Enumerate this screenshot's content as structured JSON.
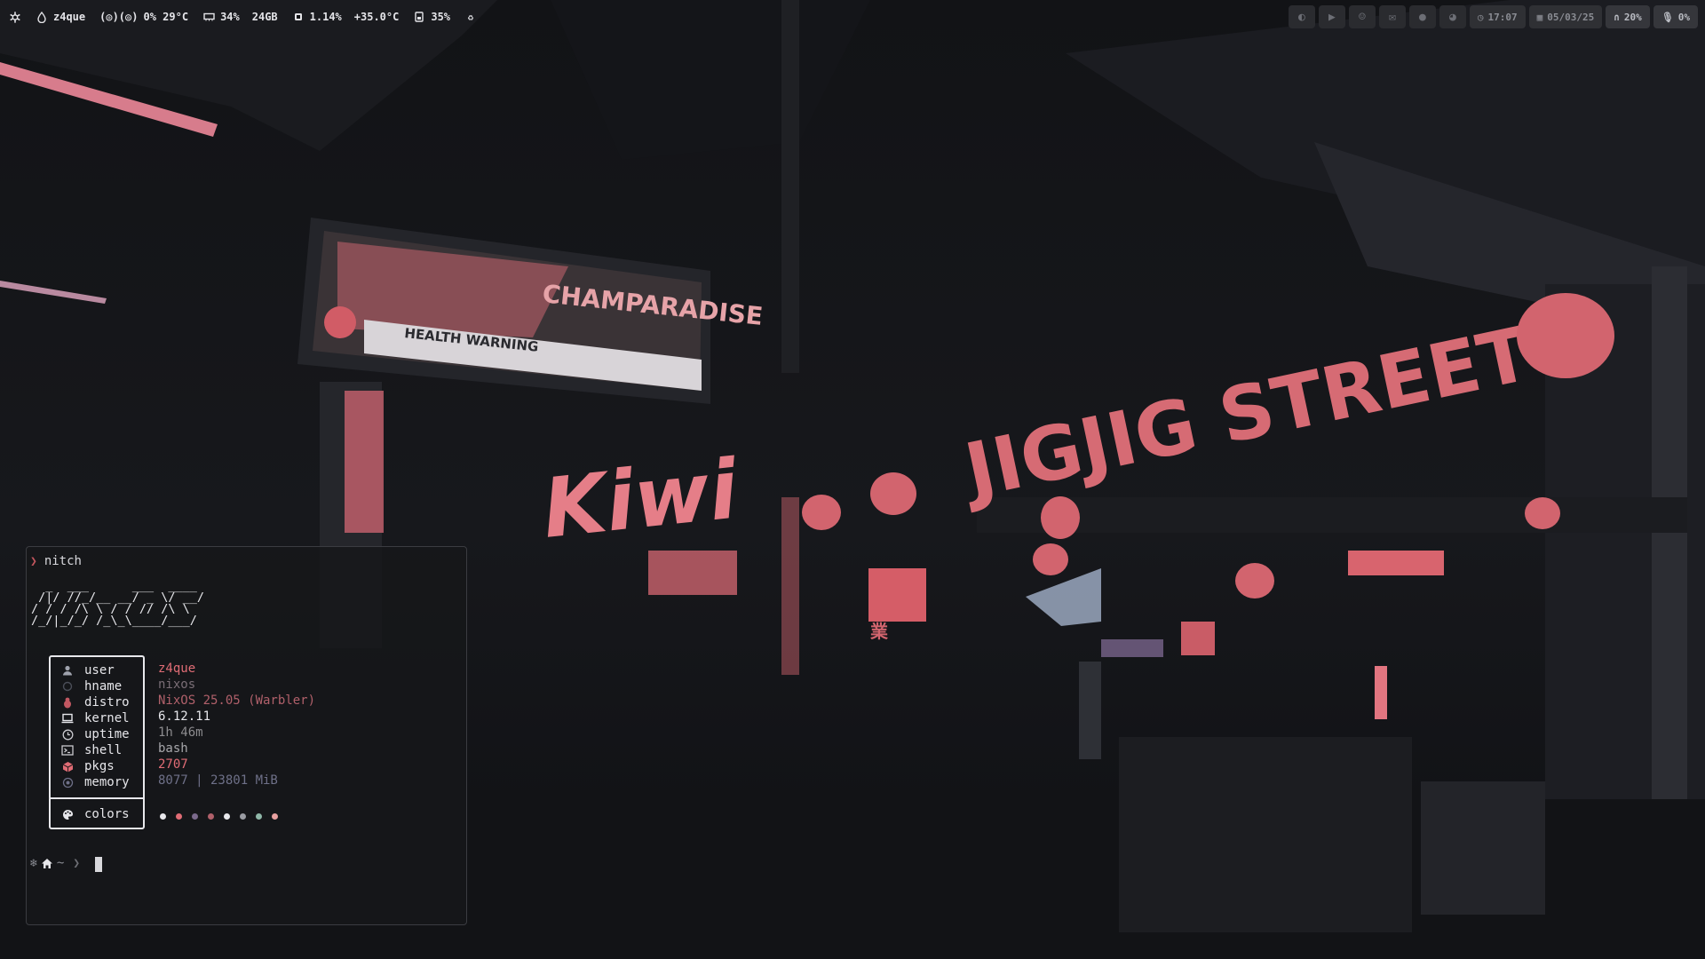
{
  "topbar": {
    "user_label": "z4que",
    "cpu_temp": "0% 29°C",
    "ram_percent": "34%",
    "ram_total": "24GB",
    "load_percent": "1.14%",
    "load_temp": "+35.0°C",
    "disk_percent": "35%",
    "apps": [
      "steam-icon",
      "youtube-icon",
      "discord-icon",
      "mail-icon",
      "reddit-icon",
      "github-icon"
    ],
    "clock": "17:07",
    "date": "05/03/25",
    "volume": "20%",
    "mic": "0%"
  },
  "wallpaper": {
    "sign_street": "JIGJIG STREET",
    "sign_billboard": "CHAMPARADISE",
    "sign_billboard_sub": "HEALTH WARNING",
    "sign_neon": "Kiwi",
    "sign_small": "業"
  },
  "terminal": {
    "command": "nitch",
    "ascii_logo": "  _  ___      ___  ____\n /|/ //_/__ __/ _ \\/ __/\n/ / / /\\ \\ / / // /\\ \\\n/_/|_/_/ /_\\_\\____/___/",
    "info": [
      {
        "icon": "user-icon",
        "label": "user",
        "value": "z4que",
        "color": "#e06c75"
      },
      {
        "icon": "host-icon",
        "label": "hname",
        "value": "nixos",
        "color": "#7a6e76"
      },
      {
        "icon": "distro-icon",
        "label": "distro",
        "value": "NixOS 25.05 (Warbler)",
        "color": "#b0606a"
      },
      {
        "icon": "kernel-icon",
        "label": "kernel",
        "value": "6.12.11",
        "color": "#e6e6ea"
      },
      {
        "icon": "clock-icon",
        "label": "uptime",
        "value": "1h 46m",
        "color": "#8c8b8e"
      },
      {
        "icon": "shell-icon",
        "label": "shell",
        "value": "bash",
        "color": "#a7a7ab"
      },
      {
        "icon": "package-icon",
        "label": "pkgs",
        "value": "2707",
        "color": "#e06c75"
      },
      {
        "icon": "memory-icon",
        "label": "memory",
        "value": "8077 | 23801 MiB",
        "color": "#6e7088"
      }
    ],
    "colors_label": "colors",
    "palette": [
      "#e8e8ec",
      "#e06c75",
      "#7b6a8c",
      "#b0606a",
      "#e8e8ec",
      "#9a9ca3",
      "#8fb7a8",
      "#e8a0a0"
    ],
    "prompt_dir": "~"
  }
}
